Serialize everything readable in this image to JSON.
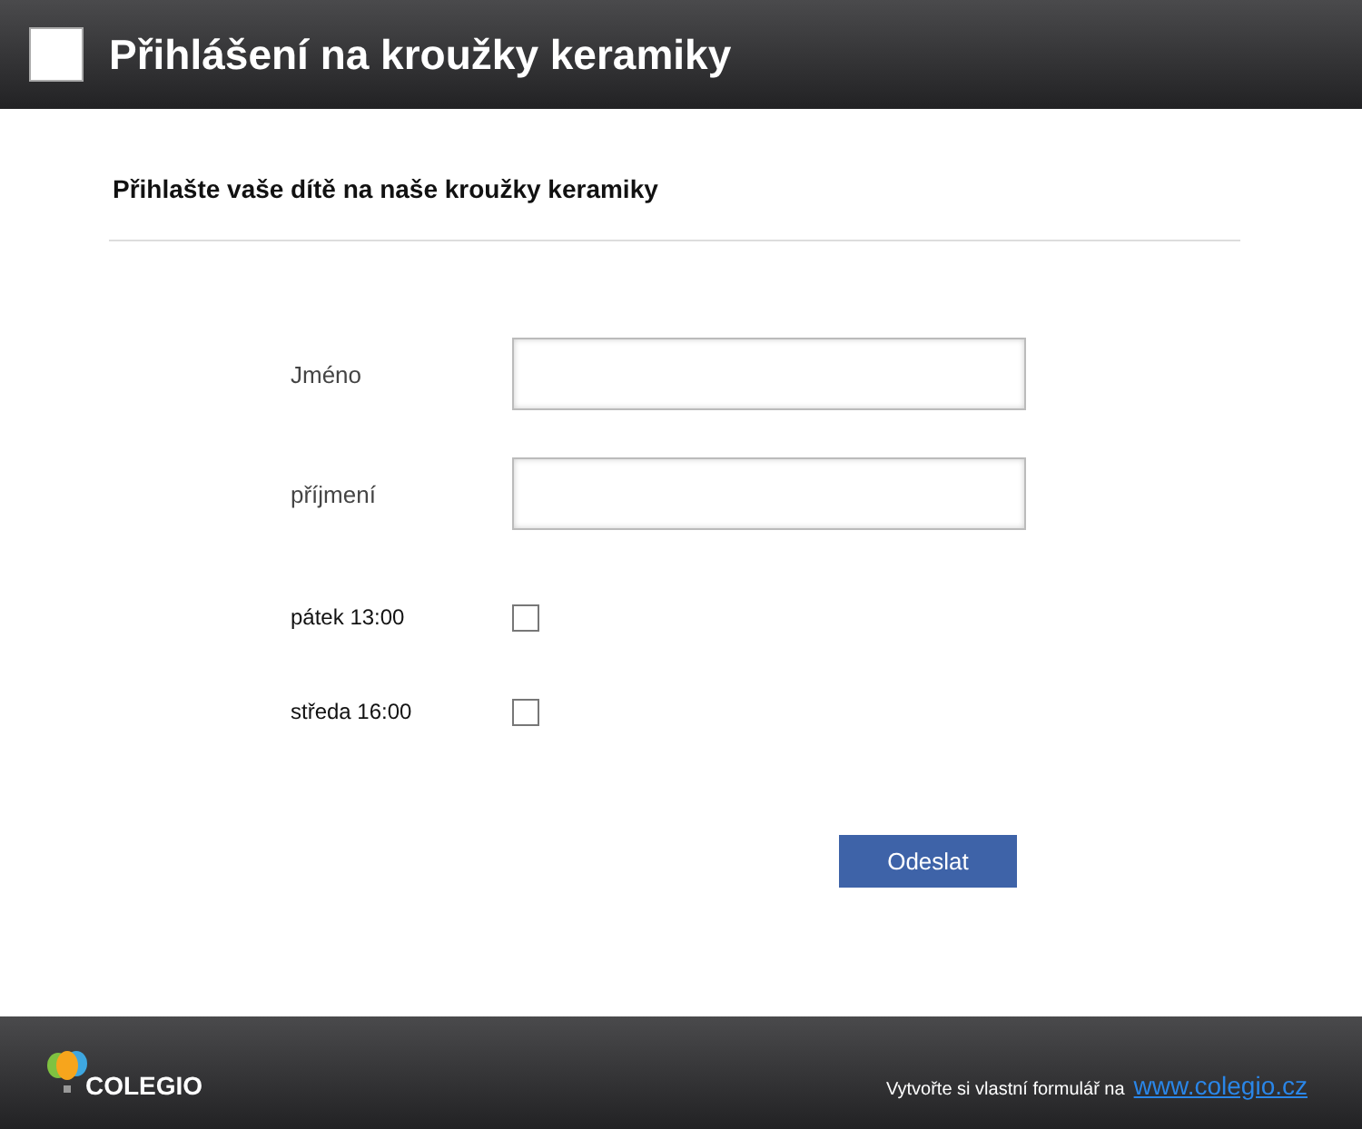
{
  "header": {
    "title": "Přihlášení na kroužky keramiky"
  },
  "form": {
    "heading": "Přihlašte vaše dítě na naše kroužky keramiky",
    "fields": [
      {
        "kind": "text",
        "label": "Jméno"
      },
      {
        "kind": "text",
        "label": "příjmení"
      },
      {
        "kind": "checkbox",
        "label": "pátek 13:00",
        "checked": false
      },
      {
        "kind": "checkbox",
        "label": "středa 16:00",
        "checked": false
      }
    ],
    "submit": "Odeslat"
  },
  "footer": {
    "brand": "COLEGIO",
    "note": "Vytvořte si vlastní formulář na",
    "link": "www.colegio.cz"
  }
}
